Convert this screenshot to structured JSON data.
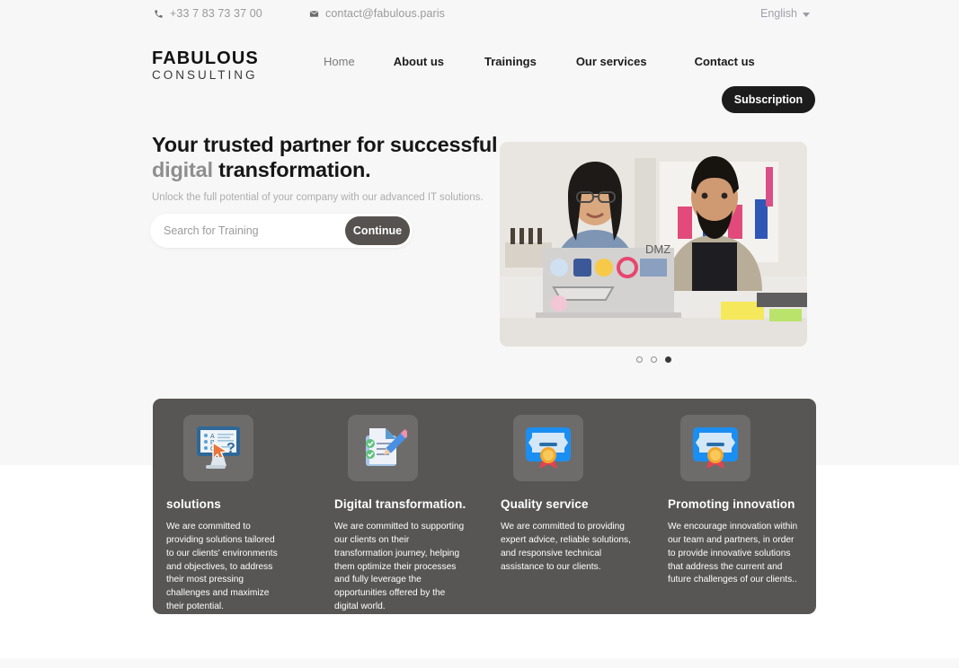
{
  "topbar": {
    "phone": "+33 7 83 73 37 00",
    "phone_icon": "phone-icon",
    "email": "contact@fabulous.paris",
    "email_icon": "envelope-icon",
    "language": "English",
    "language_chevron_icon": "chevron-down-icon"
  },
  "header": {
    "logo_line1": "FABULOUS",
    "logo_line2": "CONSULTING",
    "nav": [
      {
        "label": "Home",
        "active": true
      },
      {
        "label": "About us",
        "active": false
      },
      {
        "label": "Trainings",
        "active": false
      },
      {
        "label": "Our services",
        "active": false
      },
      {
        "label": "Contact us",
        "active": false
      }
    ],
    "subscription_label": "Subscription"
  },
  "hero": {
    "title_line1": "Your trusted partner for successful",
    "title_highlight": "digital",
    "title_rest": " transformation.",
    "subtitle": "Unlock the full potential of your company with our advanced IT solutions.",
    "search_placeholder": "Search for Training",
    "search_value": "",
    "continue_label": "Continue",
    "image_alt": "two-colleagues-at-desk-with-laptops",
    "carousel": {
      "total": 3,
      "active_index": 3
    }
  },
  "features": [
    {
      "icon": "computer-quiz-icon",
      "title": "solutions",
      "body": "We are committed to providing solutions tailored to our clients' environments and objectives, to address their most pressing challenges and maximize their potential."
    },
    {
      "icon": "checklist-pencil-icon",
      "title": "Digital transformation.",
      "body": "We are committed to supporting our clients on their transformation journey, helping them optimize their processes and fully leverage the opportunities offered by the digital world."
    },
    {
      "icon": "certificate-award-icon",
      "title": "Quality service",
      "body": "We are committed to providing expert advice, reliable solutions, and responsive technical assistance to our clients."
    },
    {
      "icon": "certificate-award-icon",
      "title": "Promoting innovation",
      "body": "We encourage innovation within our team and partners, in order to provide innovative solutions that address the current and future challenges of our clients.."
    }
  ],
  "colors": {
    "page_bg_top": "#f7f7f7",
    "page_bg_mid": "#ffffff",
    "panel_bg": "#585654",
    "tile_bg": "#6e6c6a",
    "button_dark": "#1c1c1c",
    "button_continue": "#55524f",
    "muted_text": "#9a9a9a"
  }
}
